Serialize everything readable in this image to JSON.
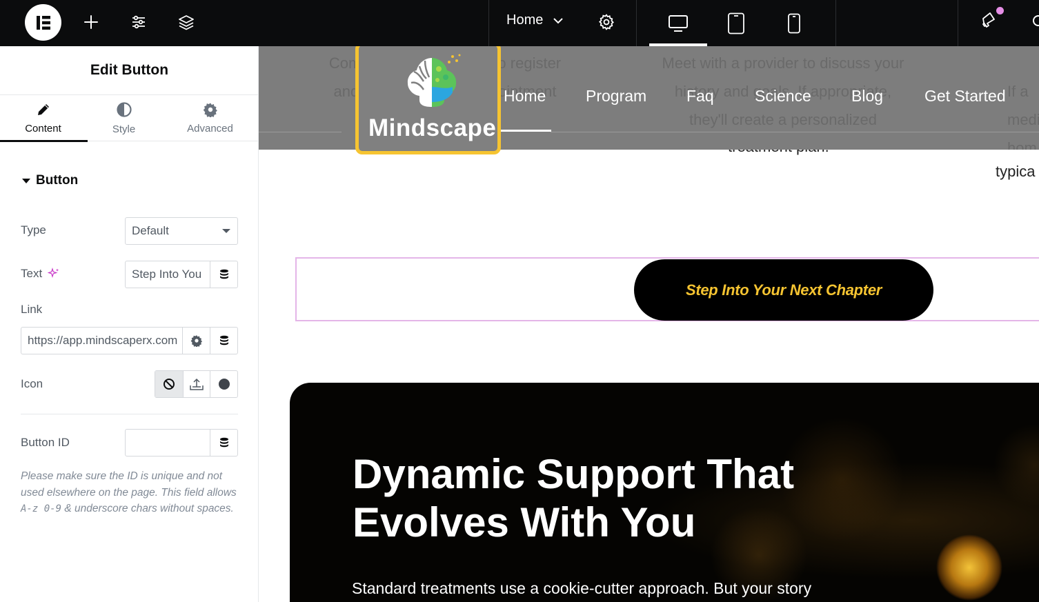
{
  "topbar": {
    "page_name": "Home"
  },
  "panel": {
    "title": "Edit Button",
    "tabs": [
      {
        "label": "Content"
      },
      {
        "label": "Style"
      },
      {
        "label": "Advanced"
      }
    ],
    "section": "Button",
    "fields": {
      "type": {
        "label": "Type",
        "value": "Default"
      },
      "text": {
        "label": "Text",
        "value": "Step Into You"
      },
      "link": {
        "label": "Link",
        "value": "https://app.mindscaperx.com"
      },
      "icon": {
        "label": "Icon"
      },
      "button_id": {
        "label": "Button ID",
        "value": ""
      }
    },
    "help_text": {
      "before": "Please make sure the ID is unique and not used elsewhere on the page. This field allows ",
      "code": "A-z 0-9",
      "after": " & underscore chars without spaces."
    }
  },
  "canvas": {
    "logo_text": "Mindscape",
    "nav": [
      "Home",
      "Program",
      "Faq",
      "Science",
      "Blog",
      "Get Started"
    ],
    "ghost_text": {
      "left": [
        "Complete a short intake to register",
        "and book your initial appointment"
      ],
      "mid": [
        "Meet with a provider to discuss your",
        "history and goals. If appropriate,",
        "they'll create a personalized",
        "treatment plan."
      ],
      "right": [
        "If a",
        "medic",
        "hom"
      ]
    },
    "visible_under": {
      "mid": "treatment plan.",
      "right": "typica"
    },
    "cta_label": "Step Into Your Next Chapter",
    "dark_title_line1": "Dynamic Support That",
    "dark_title_line2": "Evolves With You",
    "dark_sub": "Standard treatments use a cookie-cutter approach. But your story"
  },
  "colors": {
    "cta_text": "#f6c431",
    "logo_border": "#f6c431",
    "selection_border": "#e4b5e8",
    "topbar_bg": "#0b0c0d"
  },
  "icons": [
    "elementor-logo-icon",
    "add-icon",
    "settings-sliders-icon",
    "layers-icon",
    "chevron-down-icon",
    "gear-icon",
    "desktop-icon",
    "tablet-icon",
    "mobile-icon",
    "megaphone-icon",
    "search-icon",
    "pencil-icon",
    "contrast-icon",
    "database-icon",
    "ban-icon",
    "upload-icon",
    "circle-icon",
    "chevron-left-icon"
  ]
}
